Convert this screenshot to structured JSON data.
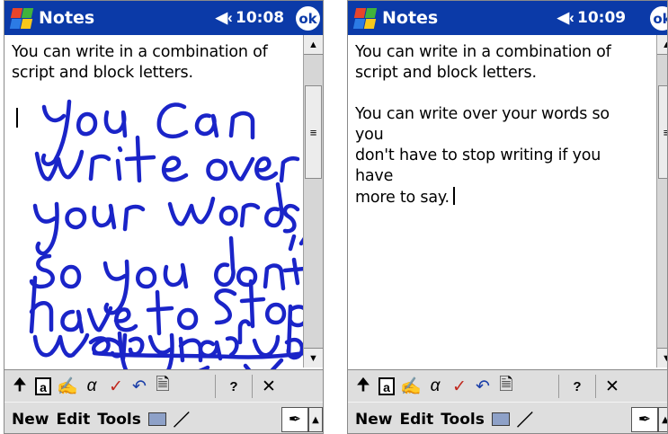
{
  "screens": [
    {
      "app_title": "Notes",
      "time": "10:08",
      "ok_label": "ok",
      "typed_lines": [
        "You can write in a combination of",
        "script and block letters."
      ],
      "ink_text": "You can write over your words so you don't have to stop writing if you have more to say",
      "menu": [
        "New",
        "Edit",
        "Tools"
      ]
    },
    {
      "app_title": "Notes",
      "time": "10:09",
      "ok_label": "ok",
      "typed_lines": [
        "You can write in a combination of",
        "script and block letters."
      ],
      "paragraph_lines": [
        "You can write over your words so you",
        "don't have to stop writing if you have",
        "more to say."
      ],
      "menu": [
        "New",
        "Edit",
        "Tools"
      ]
    }
  ],
  "toolbar_icons": [
    "up-arrow-icon",
    "recognizer-icon",
    "pen-pad-icon",
    "alpha-icon",
    "spell-check-icon",
    "undo-icon",
    "properties-icon",
    "help-icon",
    "close-icon"
  ],
  "colors": {
    "titlebar": "#0b3aa8",
    "ink": "#1a24c8",
    "bars": "#dedede"
  }
}
